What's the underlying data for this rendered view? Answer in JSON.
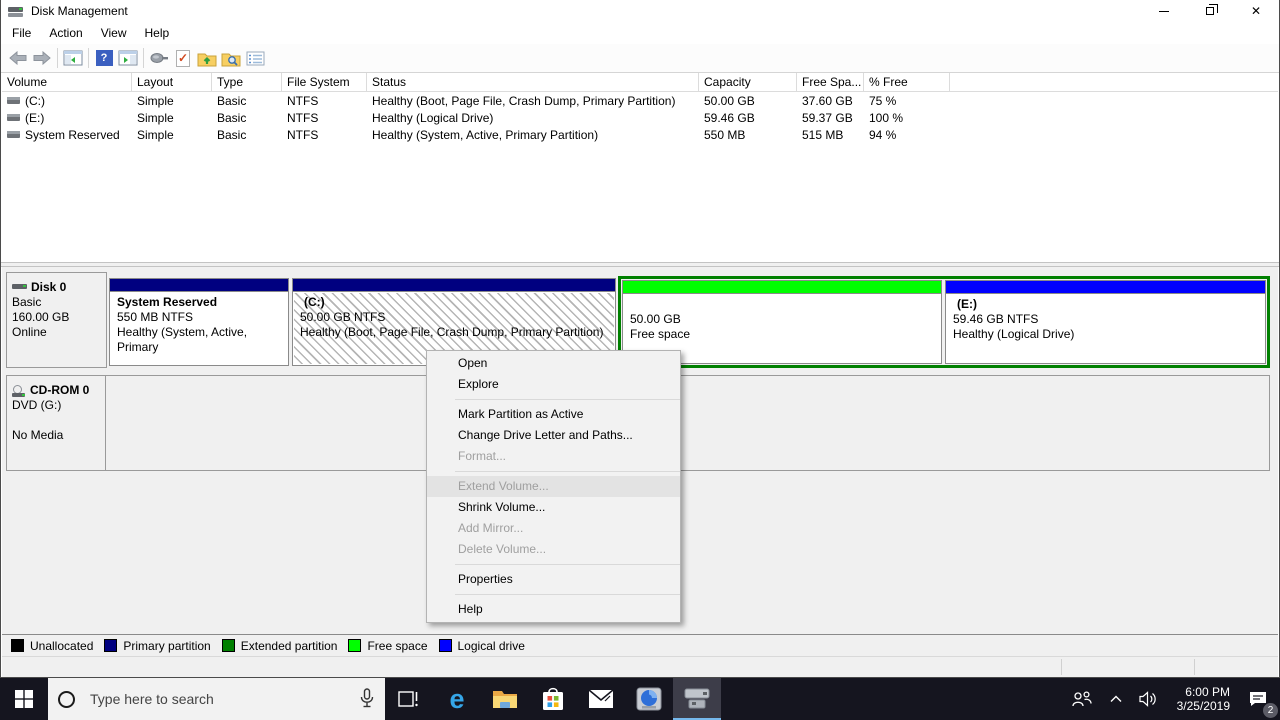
{
  "window": {
    "title": "Disk Management",
    "menu": {
      "file": "File",
      "action": "Action",
      "view": "View",
      "help": "Help"
    },
    "controls": [
      "minimize",
      "restore",
      "close"
    ],
    "toolbar_icons": [
      "back",
      "forward",
      "show-console-tree",
      "help",
      "show-action-pane",
      "tools",
      "check-document",
      "open-folder",
      "find-folder",
      "properties-list"
    ]
  },
  "volume_table": {
    "columns": [
      "Volume",
      "Layout",
      "Type",
      "File System",
      "Status",
      "Capacity",
      "Free Spa...",
      "% Free"
    ],
    "rows": [
      {
        "volume": "(C:)",
        "layout": "Simple",
        "type": "Basic",
        "fs": "NTFS",
        "status": "Healthy (Boot, Page File, Crash Dump, Primary Partition)",
        "capacity": "50.00 GB",
        "free": "37.60 GB",
        "pct": "75 %"
      },
      {
        "volume": "(E:)",
        "layout": "Simple",
        "type": "Basic",
        "fs": "NTFS",
        "status": "Healthy (Logical Drive)",
        "capacity": "59.46 GB",
        "free": "59.37 GB",
        "pct": "100 %"
      },
      {
        "volume": "System Reserved",
        "layout": "Simple",
        "type": "Basic",
        "fs": "NTFS",
        "status": "Healthy (System, Active, Primary Partition)",
        "capacity": "550 MB",
        "free": "515 MB",
        "pct": "94 %"
      }
    ]
  },
  "graph": {
    "disk0": {
      "name": "Disk 0",
      "type": "Basic",
      "size": "160.00 GB",
      "status": "Online",
      "system_reserved": {
        "l1": "System Reserved",
        "l2": "550 MB NTFS",
        "l3": "Healthy (System, Active, Primary"
      },
      "c": {
        "l1": "(C:)",
        "l2": "50.00 GB NTFS",
        "l3": "Healthy (Boot, Page File, Crash Dump, Primary Partition)"
      },
      "free": {
        "l2": "50.00 GB",
        "l3": "Free space"
      },
      "e": {
        "l1": "(E:)",
        "l2": "59.46 GB NTFS",
        "l3": "Healthy (Logical Drive)"
      }
    },
    "cdrom": {
      "name": "CD-ROM 0",
      "line1": "DVD (G:)",
      "line2": "No Media"
    }
  },
  "context_menu": {
    "items": [
      {
        "label": "Open",
        "enabled": true
      },
      {
        "label": "Explore",
        "enabled": true
      },
      {
        "label": "Mark Partition as Active",
        "enabled": true
      },
      {
        "label": "Change Drive Letter and Paths...",
        "enabled": true
      },
      {
        "label": "Format...",
        "enabled": false
      },
      {
        "label": "Extend Volume...",
        "enabled": false,
        "highlighted": true
      },
      {
        "label": "Shrink Volume...",
        "enabled": true
      },
      {
        "label": "Add Mirror...",
        "enabled": false
      },
      {
        "label": "Delete Volume...",
        "enabled": false
      },
      {
        "label": "Properties",
        "enabled": true
      },
      {
        "label": "Help",
        "enabled": true
      }
    ]
  },
  "legend": {
    "items": [
      {
        "label": "Unallocated",
        "color": "#000000"
      },
      {
        "label": "Primary partition",
        "color": "#000080"
      },
      {
        "label": "Extended partition",
        "color": "#008000"
      },
      {
        "label": "Free space",
        "color": "#00ff00"
      },
      {
        "label": "Logical drive",
        "color": "#0000ff"
      }
    ]
  },
  "colors": {
    "primary_partition": "#000080",
    "extended_partition": "#008000",
    "free_space": "#00ff00",
    "logical_drive": "#0000ff",
    "unallocated": "#000000",
    "taskbar": "#15151f",
    "active_app_underline": "#76b9ed"
  },
  "taskbar": {
    "search_placeholder": "Type here to search",
    "icons": [
      "start",
      "cortana-search",
      "microphone",
      "task-view",
      "edge",
      "file-explorer",
      "store",
      "mail",
      "defrag-tool",
      "disk-management"
    ],
    "tray_icons": [
      "people",
      "chevron-up",
      "speaker",
      "action-center"
    ],
    "time": "6:00 PM",
    "date": "3/25/2019",
    "notification_count": "2"
  }
}
